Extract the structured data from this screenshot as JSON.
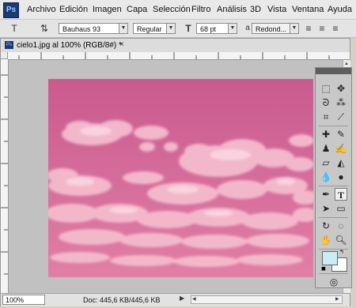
{
  "menubar": {
    "logo": "Ps",
    "items": [
      "Archivo",
      "Edición",
      "Imagen",
      "Capa",
      "Selección",
      "Filtro",
      "Análisis",
      "3D",
      "Vista",
      "Ventana",
      "Ayuda"
    ]
  },
  "options": {
    "font_family": "Bauhaus 93",
    "font_style": "Regular",
    "font_size": "68 pt",
    "antialias_label": "a",
    "antialias": "Redond..."
  },
  "document": {
    "title": "cielo1.jpg al 100% (RGB/8#) *",
    "zoom": "100%",
    "doc_info": "Doc: 445,6 KB/445,6 KB"
  },
  "colors": {
    "sky_top": "#c95a8f",
    "sky_bottom": "#e17fa4",
    "cloud": "#f6c3d2",
    "foreground": "#c9ecf7",
    "background": "#ffffff"
  }
}
